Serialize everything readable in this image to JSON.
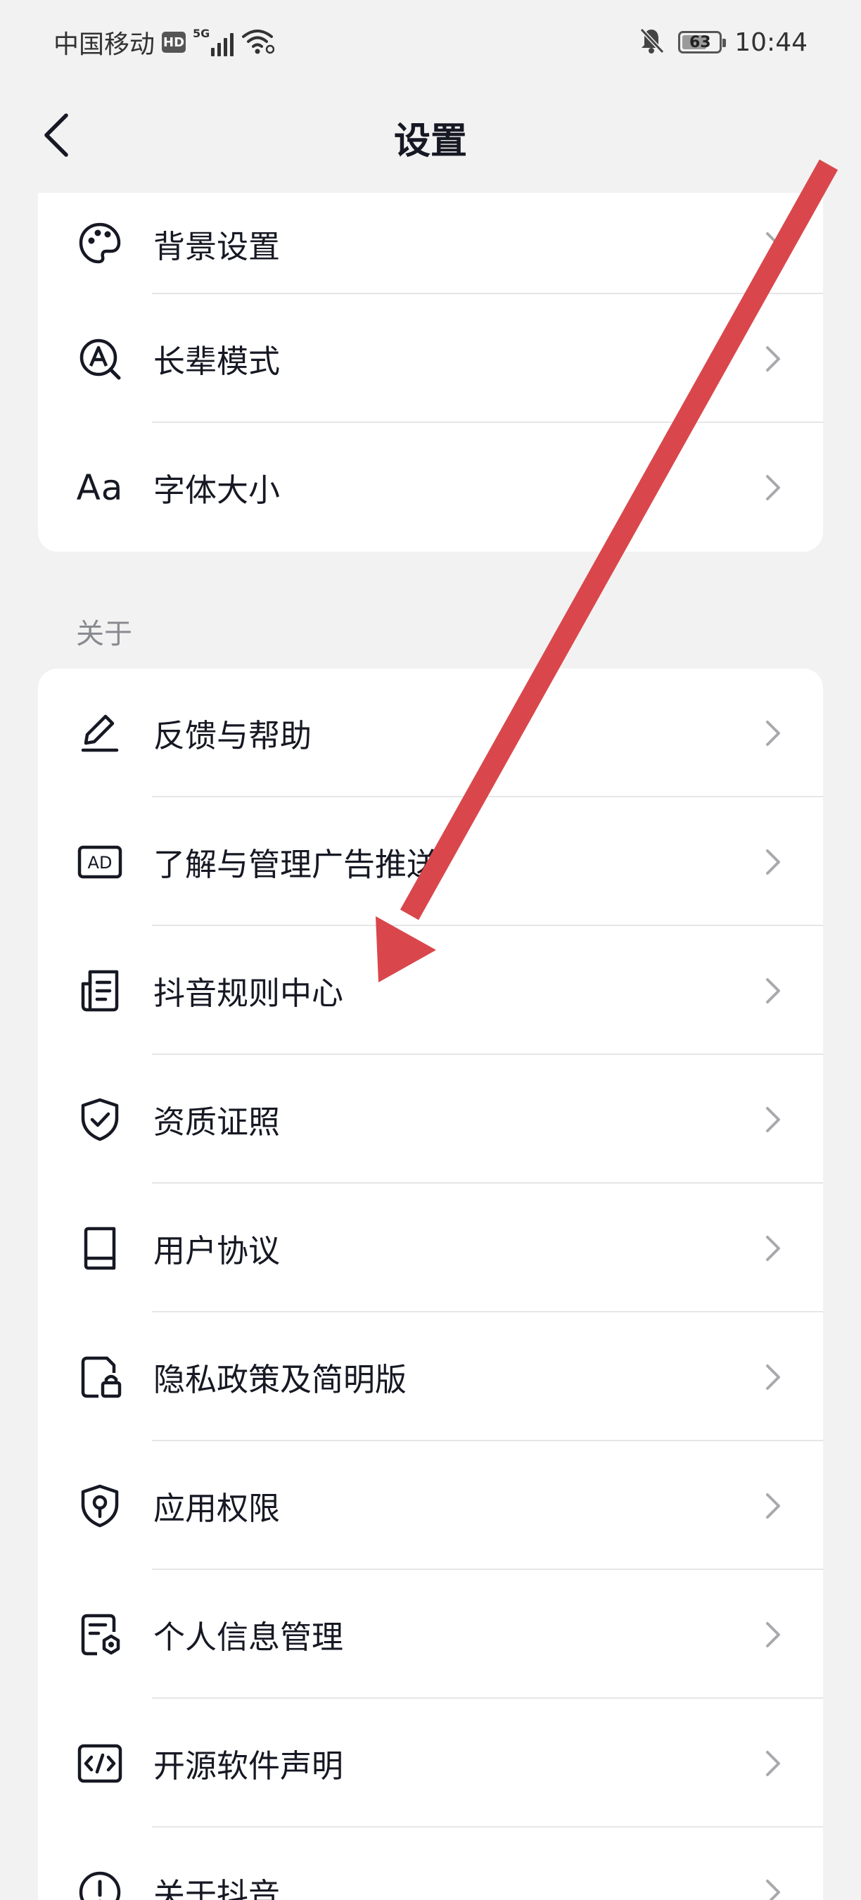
{
  "status_bar": {
    "carrier": "中国移动",
    "hd": "HD",
    "network": "5G",
    "battery": "63",
    "time": "10:44"
  },
  "header": {
    "title": "设置"
  },
  "appearance": {
    "items": [
      {
        "label": "背景设置",
        "icon": "palette-icon"
      },
      {
        "label": "长辈模式",
        "icon": "elder-mode-icon"
      },
      {
        "label": "字体大小",
        "icon": "font-size-icon",
        "icon_text": "Aa"
      }
    ]
  },
  "about": {
    "title": "关于",
    "items": [
      {
        "label": "反馈与帮助",
        "icon": "pencil-icon"
      },
      {
        "label": "了解与管理广告推送",
        "icon": "ad-icon",
        "icon_text": "AD"
      },
      {
        "label": "抖音规则中心",
        "icon": "document-icon"
      },
      {
        "label": "资质证照",
        "icon": "shield-check-icon"
      },
      {
        "label": "用户协议",
        "icon": "book-icon"
      },
      {
        "label": "隐私政策及简明版",
        "icon": "document-lock-icon"
      },
      {
        "label": "应用权限",
        "icon": "shield-key-icon"
      },
      {
        "label": "个人信息管理",
        "icon": "document-settings-icon"
      },
      {
        "label": "开源软件声明",
        "icon": "code-icon"
      },
      {
        "label": "关于抖音",
        "icon": "info-icon"
      }
    ]
  },
  "colors": {
    "background": "#f2f2f2",
    "card": "#ffffff",
    "text": "#161823",
    "secondary_text": "#8a8b91",
    "annotation_arrow": "#d9474c"
  }
}
